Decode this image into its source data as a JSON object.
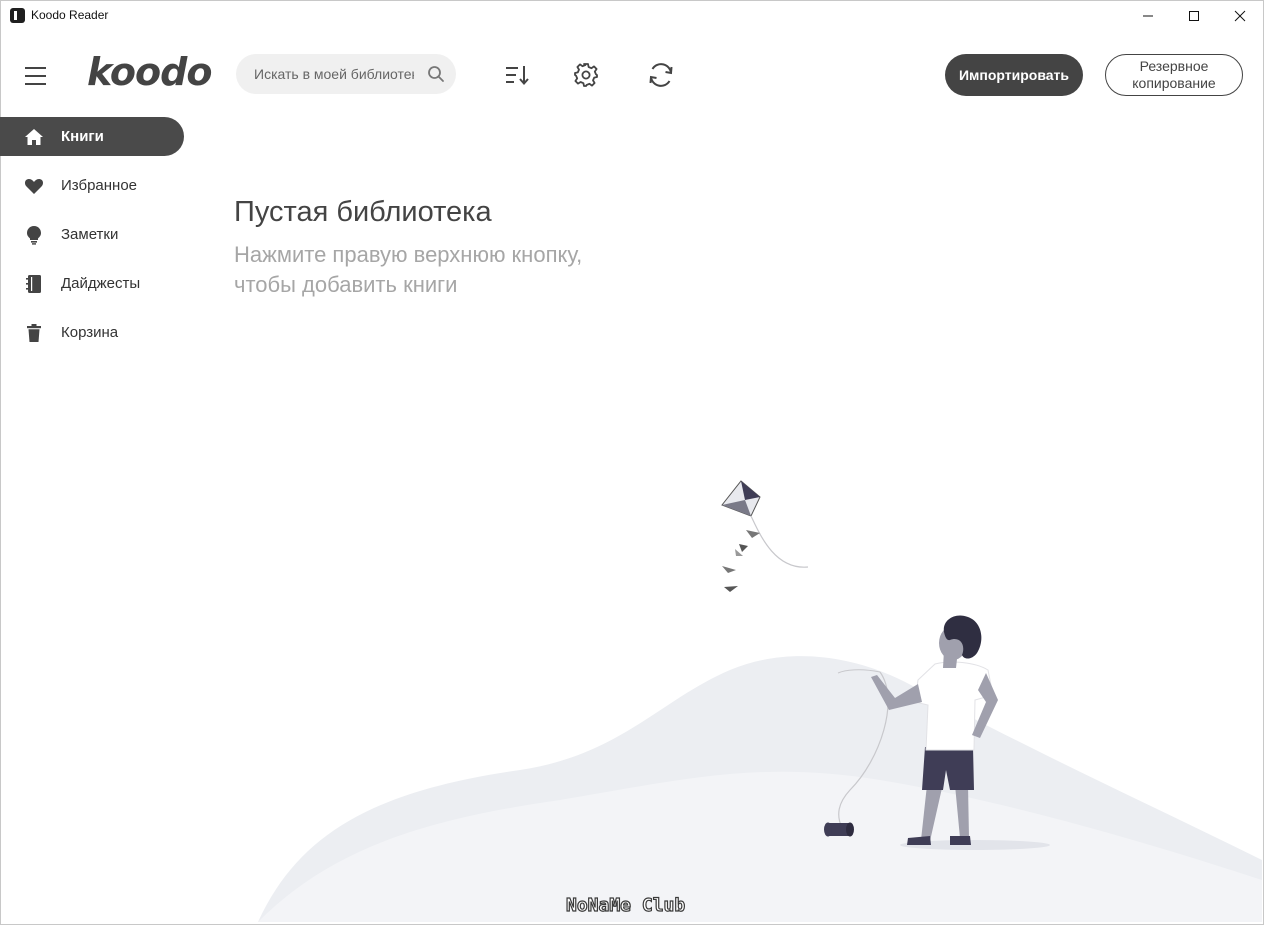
{
  "window": {
    "title": "Koodo Reader"
  },
  "header": {
    "logo": "koodo",
    "search_placeholder": "Искать в моей библиотеке",
    "import_label": "Импортировать",
    "backup_label": "Резервное копирование"
  },
  "sidebar": {
    "items": [
      {
        "label": "Книги",
        "icon": "home-icon",
        "active": true
      },
      {
        "label": "Избранное",
        "icon": "heart-icon",
        "active": false
      },
      {
        "label": "Заметки",
        "icon": "lightbulb-icon",
        "active": false
      },
      {
        "label": "Дайджесты",
        "icon": "notebook-icon",
        "active": false
      },
      {
        "label": "Корзина",
        "icon": "trash-icon",
        "active": false
      }
    ]
  },
  "main": {
    "empty_title": "Пустая библиотека",
    "empty_subtitle_line1": "Нажмите правую верхнюю кнопку,",
    "empty_subtitle_line2": "чтобы добавить книги"
  },
  "watermark": "NoNaMe Club",
  "colors": {
    "accent_dark": "#444444",
    "sidebar_active": "#4a4a4a",
    "search_bg": "#f0f0f0",
    "subtitle_gray": "#a6a6a6"
  }
}
